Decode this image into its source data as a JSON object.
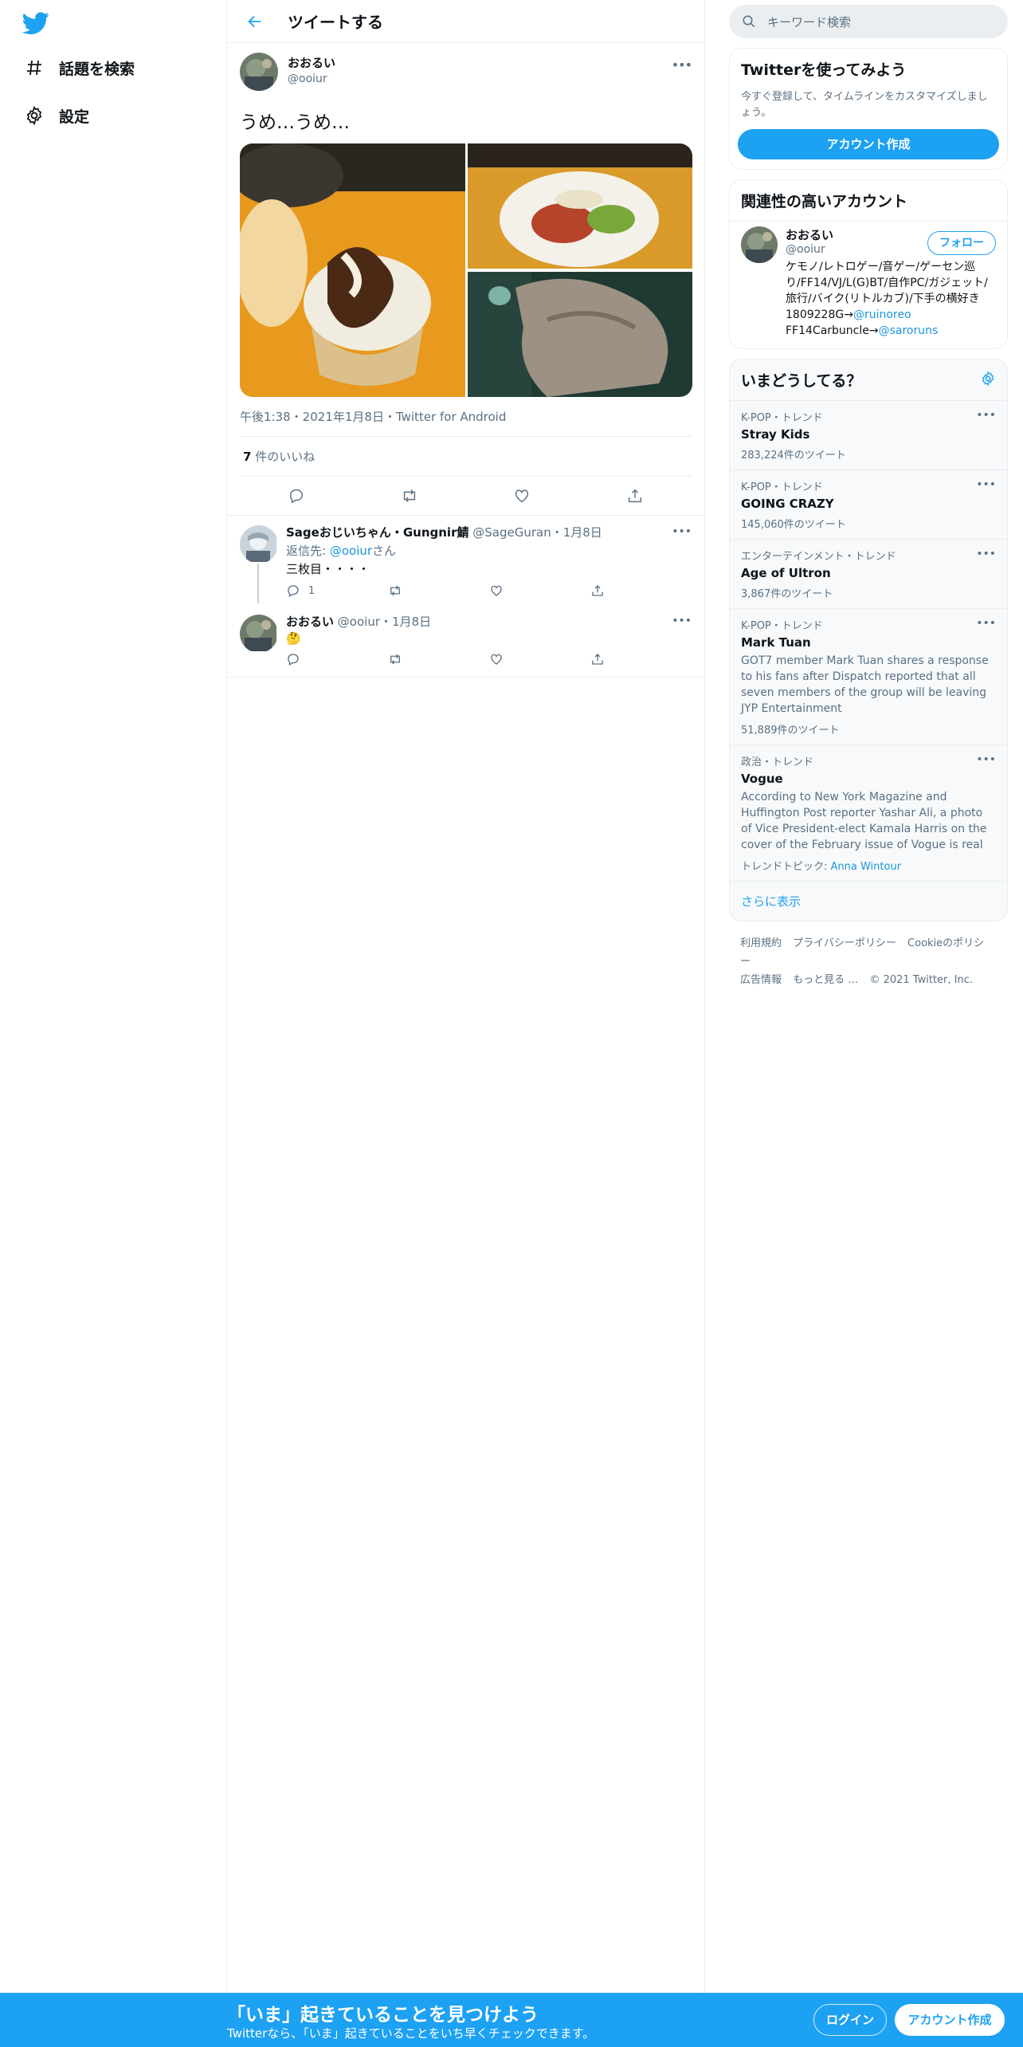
{
  "nav": {
    "items": [
      {
        "label": "話題を検索",
        "icon": "hashtag-icon"
      },
      {
        "label": "設定",
        "icon": "gear-icon"
      }
    ]
  },
  "header": {
    "title": "ツイートする"
  },
  "tweet": {
    "name": "おおるい",
    "handle": "@ooiur",
    "text": "うめ…うめ…",
    "meta": "午後1:38・2021年1月8日・Twitter for Android",
    "likes_count": "7",
    "likes_label": " 件のいいね"
  },
  "replies": [
    {
      "name": "Sageおじいちゃん・Gungnir鯖",
      "handle": "@SageGuran",
      "date": "・1月8日",
      "reply_to_prefix": "返信先: ",
      "reply_to_handle": "@ooiur",
      "reply_to_suffix": "さん",
      "text": "三枚目・・・・",
      "reply_count": "1"
    },
    {
      "name": "おおるい",
      "handle": "@ooiur",
      "date": "・1月8日",
      "text": "🤔"
    }
  ],
  "search": {
    "placeholder": "キーワード検索"
  },
  "signup_card": {
    "title": "Twitterを使ってみよう",
    "desc": "今すぐ登録して、タイムラインをカスタマイズしましょう。",
    "button": "アカウント作成"
  },
  "related": {
    "title": "関連性の高いアカウント",
    "name": "おおるい",
    "handle": "@ooiur",
    "follow": "フォロー",
    "bio_prefix": "ケモノ/レトロゲー/音ゲー/ゲーセン巡り/FF14/VJ/L(G)BT/自作PC/ガジェット/旅行/バイク(リトルカブ)/下手の横好き 1809228G→",
    "bio_link1": "@ruinoreo",
    "bio_mid": "FF14Carbuncle→",
    "bio_link2": "@saroruns"
  },
  "trends": {
    "title": "いまどうしてる？",
    "items": [
      {
        "context": "K-POP・トレンド",
        "name": "Stray Kids",
        "desc": "",
        "count": "283,224件のツイート"
      },
      {
        "context": "K-POP・トレンド",
        "name": "GOING CRAZY",
        "desc": "",
        "count": "145,060件のツイート"
      },
      {
        "context": "エンターテインメント・トレンド",
        "name": "Age of Ultron",
        "desc": "",
        "count": "3,867件のツイート"
      },
      {
        "context": "K-POP・トレンド",
        "name": "Mark Tuan",
        "desc": "GOT7 member Mark Tuan shares a response to his fans after Dispatch reported that all seven members of the group will be leaving JYP Entertainment",
        "count": "51,889件のツイート"
      },
      {
        "context": "政治・トレンド",
        "name": "Vogue",
        "desc": "According to New York Magazine and Huffington Post reporter Yashar Ali, a photo of Vice President-elect Kamala Harris on the cover of the February issue of Vogue is real",
        "topic_label": "トレンドトピック: ",
        "topic_link": "Anna Wintour"
      }
    ],
    "show_more": "さらに表示"
  },
  "footer": {
    "links": [
      "利用規約",
      "プライバシーポリシー",
      "Cookieのポリシー",
      "広告情報",
      "もっと見る …",
      "© 2021 Twitter, Inc."
    ]
  },
  "bottom_bar": {
    "title": "「いま」起きていることを見つけよう",
    "sub": "Twitterなら、「いま」起きていることをいち早くチェックできます。",
    "login": "ログイン",
    "signup": "アカウント作成"
  },
  "colors": {
    "accent": "#1da1f2",
    "link": "#1b95e0",
    "border": "#ebeef0"
  }
}
